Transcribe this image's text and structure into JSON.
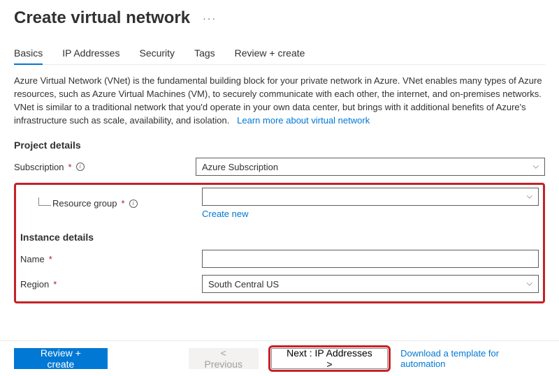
{
  "header": {
    "title": "Create virtual network"
  },
  "tabs": {
    "basics": "Basics",
    "ip": "IP Addresses",
    "security": "Security",
    "tags": "Tags",
    "review": "Review + create"
  },
  "description": {
    "text": "Azure Virtual Network (VNet) is the fundamental building block for your private network in Azure. VNet enables many types of Azure resources, such as Azure Virtual Machines (VM), to securely communicate with each other, the internet, and on-premises networks. VNet is similar to a traditional network that you'd operate in your own data center, but brings with it additional benefits of Azure's infrastructure such as scale, availability, and isolation.",
    "learn_more": "Learn more about virtual network"
  },
  "sections": {
    "project": "Project details",
    "instance": "Instance details"
  },
  "fields": {
    "subscription": {
      "label": "Subscription",
      "value": "Azure Subscription"
    },
    "resource_group": {
      "label": "Resource group",
      "value": "",
      "create_new": "Create new"
    },
    "name": {
      "label": "Name",
      "value": ""
    },
    "region": {
      "label": "Region",
      "value": "South Central US"
    }
  },
  "footer": {
    "review": "Review + create",
    "previous": "< Previous",
    "next": "Next : IP Addresses >",
    "download": "Download a template for automation"
  }
}
